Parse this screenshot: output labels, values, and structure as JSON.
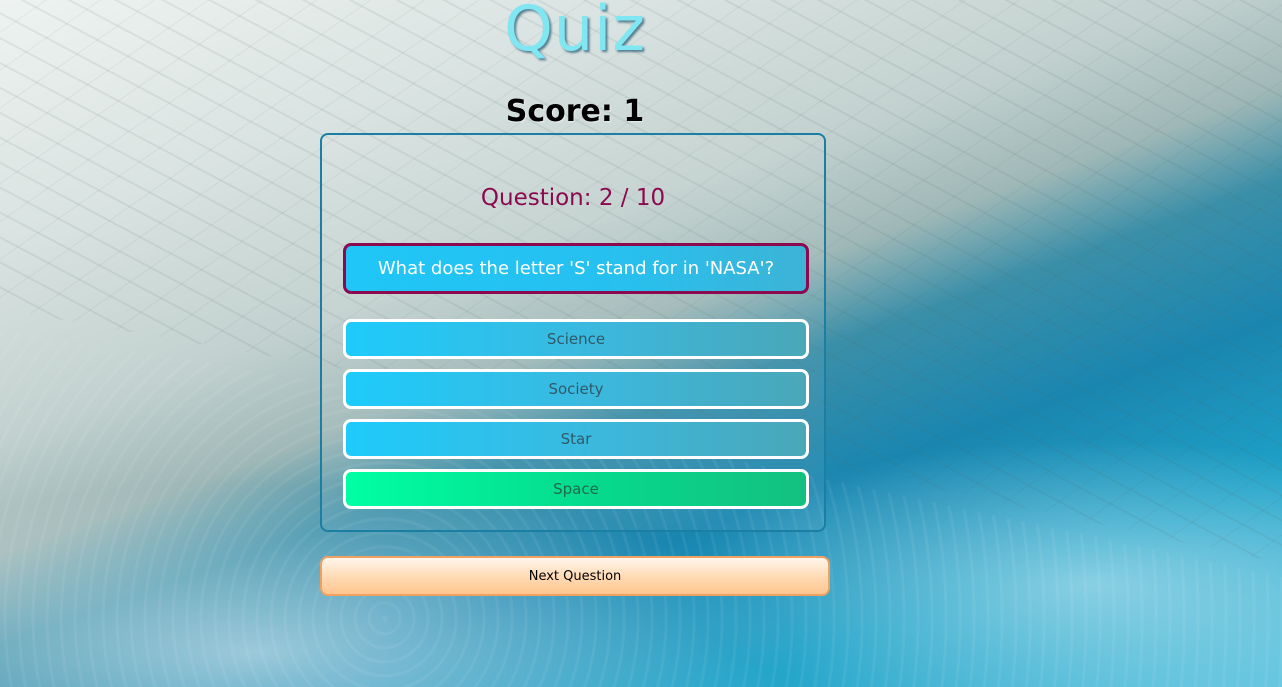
{
  "header": {
    "title": "Quiz",
    "score_label": "Score: 1"
  },
  "quiz": {
    "question_counter": "Question: 2 / 10",
    "question_text": "What does the letter 'S' stand for in 'NASA'?",
    "answers": [
      {
        "label": "Science",
        "state": "default"
      },
      {
        "label": "Society",
        "state": "default"
      },
      {
        "label": "Star",
        "state": "default"
      },
      {
        "label": "Space",
        "state": "correct"
      }
    ]
  },
  "footer": {
    "next_label": "Next Question"
  },
  "colors": {
    "title": "#7fe6f2",
    "question_accent": "#8b0a4f",
    "answer_default": "#1ecbfb",
    "answer_correct": "#00ffa4",
    "next_button": "#ffd7ad"
  }
}
